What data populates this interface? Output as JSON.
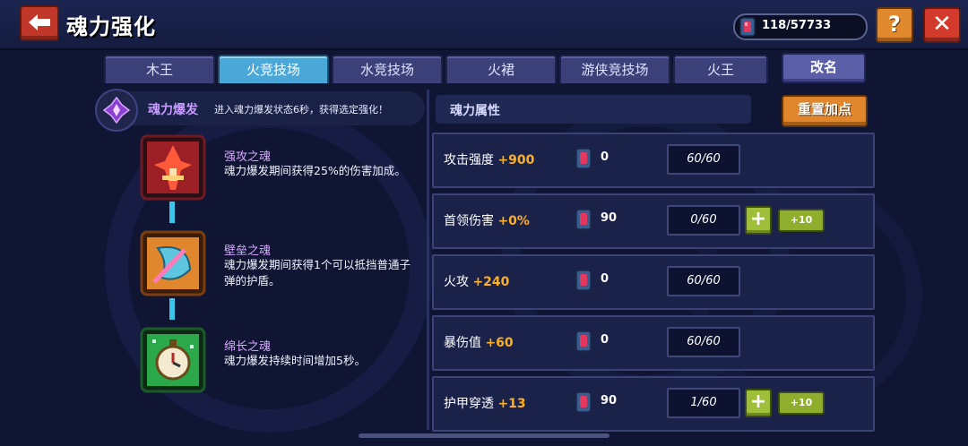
{
  "header": {
    "title": "魂力强化",
    "currency": "118/57733",
    "help_label": "?",
    "close_label": "✕"
  },
  "tabs": [
    {
      "label": "木王"
    },
    {
      "label": "火竞技场",
      "active": true
    },
    {
      "label": "水竞技场"
    },
    {
      "label": "火裙"
    },
    {
      "label": "游侠竞技场"
    },
    {
      "label": "火王"
    }
  ],
  "rename_label": "改名",
  "burst": {
    "title": "魂力爆发",
    "desc": "进入魂力爆发状态6秒，获得选定强化！"
  },
  "souls": [
    {
      "name": "强攻之魂",
      "desc": "魂力爆发期间获得25%的伤害加成。"
    },
    {
      "name": "壁垒之魂",
      "desc": "魂力爆发期间获得1个可以抵挡普通子弹的护盾。"
    },
    {
      "name": "绵长之魂",
      "desc": "魂力爆发持续时间增加5秒。"
    }
  ],
  "attr": {
    "title": "魂力属性",
    "reset_label": "重置加点",
    "plus_label": "+",
    "plus10_label": "+10",
    "stats": [
      {
        "name": "攻击强度",
        "bonus": "+900",
        "cost": "0",
        "level": "60/60",
        "upgradable": false
      },
      {
        "name": "首领伤害",
        "bonus": "+0%",
        "cost": "90",
        "level": "0/60",
        "upgradable": true
      },
      {
        "name": "火攻",
        "bonus": "+240",
        "cost": "0",
        "level": "60/60",
        "upgradable": false
      },
      {
        "name": "暴伤值",
        "bonus": "+60",
        "cost": "0",
        "level": "60/60",
        "upgradable": false
      },
      {
        "name": "护甲穿透",
        "bonus": "+13",
        "cost": "90",
        "level": "1/60",
        "upgradable": true
      }
    ]
  },
  "colors": {
    "bonus": "#ffb020",
    "active_tab": "#4aa8d8",
    "soul_name": "#d9a9ff",
    "accent_orange": "#e0862c"
  }
}
